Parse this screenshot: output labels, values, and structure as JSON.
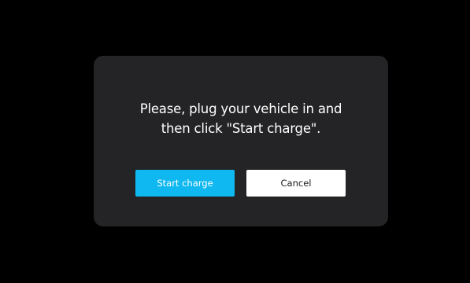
{
  "dialog": {
    "message_line1": "Please, plug your vehicle in and",
    "message_line2": "then click \"Start charge\".",
    "start_label": "Start charge",
    "cancel_label": "Cancel"
  },
  "colors": {
    "backdrop": "#000000",
    "dialog_bg": "#242426",
    "primary": "#0fb8f0",
    "secondary": "#ffffff",
    "text": "#ffffff"
  }
}
